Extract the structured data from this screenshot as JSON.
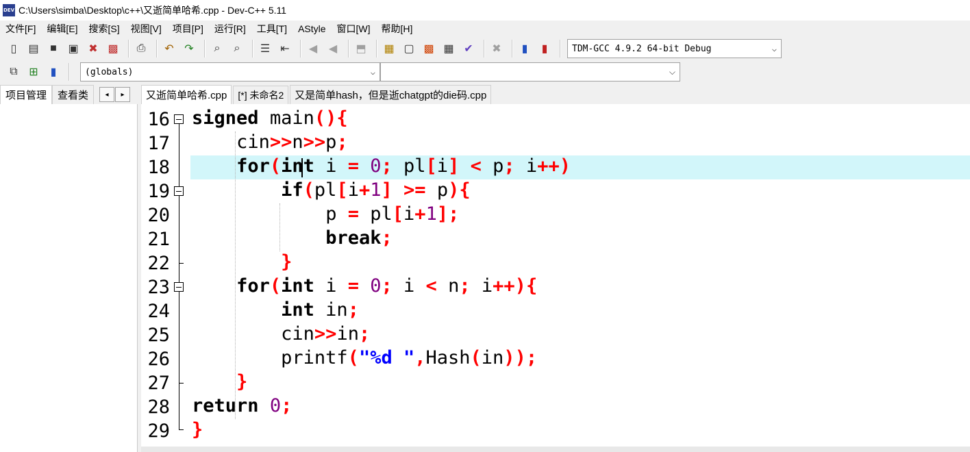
{
  "window": {
    "title": "C:\\Users\\simba\\Desktop\\c++\\又逝简单哈希.cpp - Dev-C++ 5.11",
    "icon_text": "DEV"
  },
  "menu": [
    "文件[F]",
    "编辑[E]",
    "搜索[S]",
    "视图[V]",
    "项目[P]",
    "运行[R]",
    "工具[T]",
    "AStyle",
    "窗口[W]",
    "帮助[H]"
  ],
  "toolbar": {
    "compiler": "TDM-GCC 4.9.2 64-bit Debug",
    "scope": "(globals)",
    "member": ""
  },
  "left_tabs": {
    "project": "项目管理",
    "classes": "查看类",
    "prev": "◂",
    "next": "▸"
  },
  "editor_tabs": [
    "又逝简单哈希.cpp",
    "[*] 未命名2",
    "又是简单hash，但是逝chatgpt的die码.cpp"
  ],
  "line_numbers": [
    "16",
    "17",
    "18",
    "19",
    "20",
    "21",
    "22",
    "23",
    "24",
    "25",
    "26",
    "27",
    "28",
    "29"
  ],
  "code_lines": [
    "signed main(){",
    "    cin>>n>>p;",
    "    for(int i = 0; pl[i] < p; i++)",
    "        if(pl[i+1] >= p){",
    "            p = pl[i+1];",
    "            break;",
    "        }",
    "    for(int i = 0; i < n; i++){",
    "        int in;",
    "        cin>>in;",
    "        printf(\"%d \",Hash(in));",
    "    }",
    "return 0;",
    "}"
  ],
  "colors": {
    "current_line": "#d2f6fa",
    "symbol": "#ff0000",
    "number": "#800080",
    "string": "#0000ff"
  }
}
